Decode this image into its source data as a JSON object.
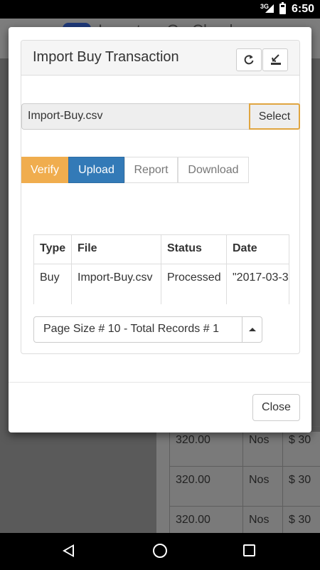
{
  "status_bar": {
    "network": "3G",
    "time": "6:50"
  },
  "background_app": {
    "title": "Inventory On Cloud",
    "rows": [
      {
        "qty": "320.00",
        "unit": "Nos",
        "price": "$ 30"
      },
      {
        "qty": "320.00",
        "unit": "Nos",
        "price": "$ 30"
      },
      {
        "qty": "320.00",
        "unit": "Nos",
        "price": "$ 30"
      }
    ]
  },
  "modal": {
    "title": "Import Buy Transaction",
    "icons": {
      "refresh": "refresh-icon",
      "download": "download-icon"
    },
    "file_input": {
      "value": "Import-Buy.csv"
    },
    "select_label": "Select",
    "tabs": [
      {
        "label": "Verify",
        "color": "#f0ad4e"
      },
      {
        "label": "Upload",
        "color": "#337ab7"
      },
      {
        "label": "Report"
      },
      {
        "label": "Download"
      }
    ],
    "table": {
      "headers": [
        "Type",
        "File",
        "Status",
        "Date"
      ],
      "rows": [
        [
          "Buy",
          "Import-Buy.csv",
          "Processed",
          "\"2017-03-3"
        ]
      ]
    },
    "pager": {
      "label": "Page Size # 10 - Total Records # 1"
    },
    "close_label": "Close"
  }
}
